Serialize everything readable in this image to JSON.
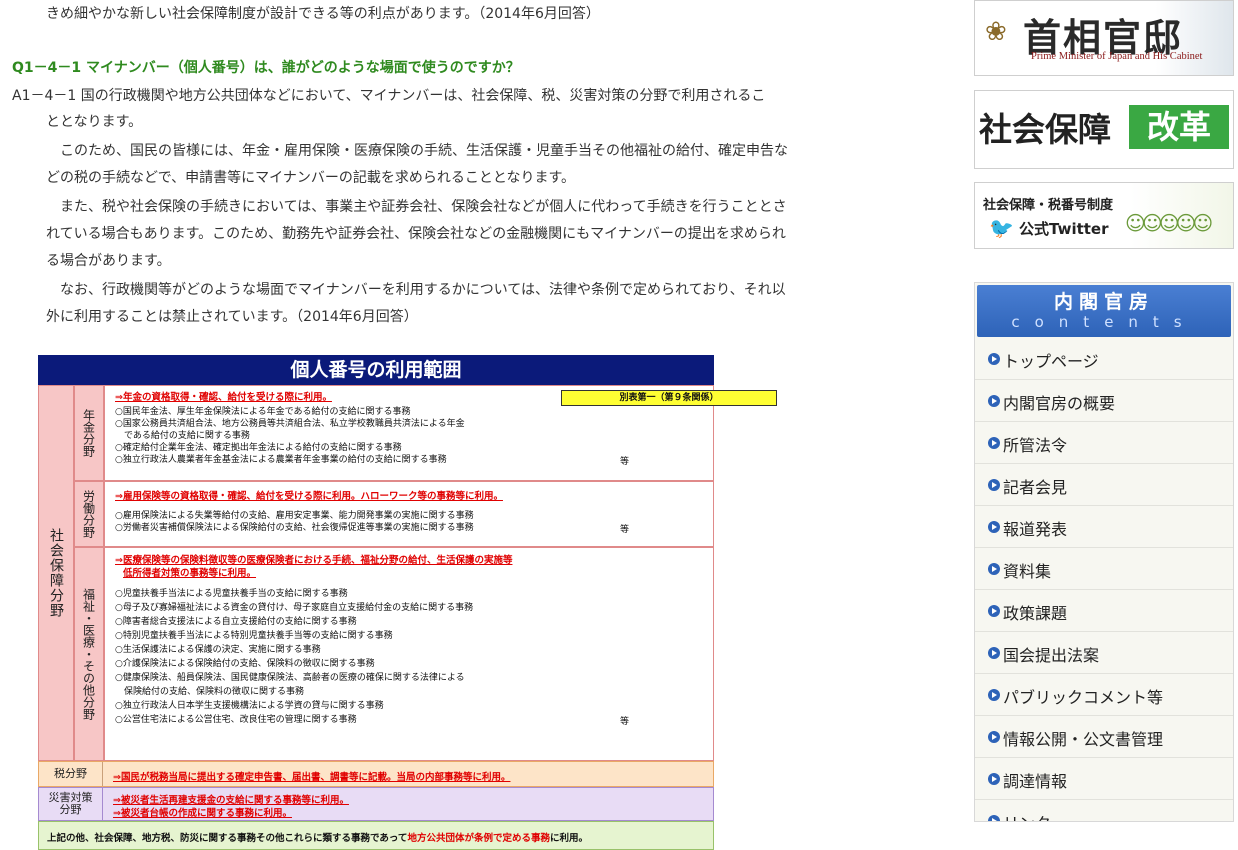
{
  "article": {
    "line0": "きめ細やかな新しい社会保障制度が設計できる等の利点があります。（2014年6月回答）",
    "question": "Q1－4－1 マイナンバー（個人番号）は、誰がどのような場面で使うのですか？",
    "answer_lines": [
      "A1－4－1 国の行政機関や地方公共団体などにおいて、マイナンバーは、社会保障、税、災害対策の分野で利用されるこ",
      "ととなります。",
      "このため、国民の皆様には、年金・雇用保険・医療保険の手続、生活保護・児童手当その他福祉の給付、確定申告な",
      "どの税の手続などで、申請書等にマイナンバーの記載を求められることとなります。",
      "また、税や社会保険の手続きにおいては、事業主や証券会社、保険会社などが個人に代わって手続きを行うこととさ",
      "れている場合もあります。このため、勤務先や証券会社、保険会社などの金融機関にもマイナンバーの提出を求められ",
      "る場合があります。",
      "なお、行政機関等がどのような場面でマイナンバーを利用するかについては、法律や条例で定められており、それ以",
      "外に利用することは禁止されています。（2014年6月回答）"
    ]
  },
  "figure": {
    "title": "個人番号の利用範囲",
    "badge": "別表第一（第９条関係）",
    "main_label": "社会保障分野",
    "pension": {
      "label": "年金分野",
      "headline": "⇒年金の資格取得・確認、給付を受ける際に利用。",
      "lines": [
        "○国民年金法、厚生年金保険法による年金である給付の支給に関する事務",
        "○国家公務員共済組合法、地方公務員等共済組合法、私立学校教職員共済法による年金",
        "　である給付の支給に関する事務",
        "○確定給付企業年金法、確定拠出年金法による給付の支給に関する事務",
        "○独立行政法人農業者年金基金法による農業者年金事業の給付の支給に関する事務"
      ],
      "etc": "等"
    },
    "labor": {
      "label": "労働分野",
      "headline": "⇒雇用保険等の資格取得・確認、給付を受ける際に利用。ハローワーク等の事務等に利用。",
      "lines": [
        "○雇用保険法による失業等給付の支給、雇用安定事業、能力開発事業の実施に関する事務",
        "○労働者災害補償保険法による保険給付の支給、社会復帰促進等事業の実施に関する事務"
      ],
      "etc": "等"
    },
    "welfare": {
      "label": "福祉・医療・その他分野",
      "headline1": "⇒医療保険等の保険料徴収等の医療保険者における手続、福祉分野の給付、生活保護の実施等",
      "headline2": "低所得者対策の事務等に利用。",
      "lines": [
        "○児童扶養手当法による児童扶養手当の支給に関する事務",
        "○母子及び寡婦福祉法による資金の貸付け、母子家庭自立支援給付金の支給に関する事務",
        "○障害者総合支援法による自立支援給付の支給に関する事務",
        "○特別児童扶養手当法による特別児童扶養手当等の支給に関する事務",
        "○生活保護法による保護の決定、実施に関する事務",
        "○介護保険法による保険給付の支給、保険料の徴収に関する事務",
        "○健康保険法、船員保険法、国民健康保険法、高齢者の医療の確保に関する法律による",
        "　保険給付の支給、保険料の徴収に関する事務",
        "○独立行政法人日本学生支援機構法による学資の貸与に関する事務",
        "○公営住宅法による公営住宅、改良住宅の管理に関する事務"
      ],
      "etc": "等"
    },
    "tax": {
      "label": "税分野",
      "text": "⇒国民が税務当局に提出する確定申告書、届出書、調書等に記載。当局の内部事務等に利用。"
    },
    "disaster": {
      "label": "災害対策分野",
      "line1": "⇒被災者生活再建支援金の支給に関する事務等に利用。",
      "line2": "⇒被災者台帳の作成に関する事務に利用。"
    },
    "other": {
      "text_a": "上記の他、社会保障、地方税、防災に関する事務その他これらに類する事務であって",
      "text_b": "地方公共団体が条例で定める事務",
      "text_c": "に利用。"
    }
  },
  "sidebar": {
    "kantei": {
      "name": "首相官邸",
      "english": "Prime Minister of Japan and His Cabinet"
    },
    "reform": {
      "part1": "社会保障",
      "part2": "改革"
    },
    "twitter": {
      "line1": "社会保障・税番号制度",
      "line2": "公式Twitter"
    },
    "menu_title": "内閣官房",
    "menu_subtitle": "contents",
    "menu_items": [
      "トップページ",
      "内閣官房の概要",
      "所管法令",
      "記者会見",
      "報道発表",
      "資料集",
      "政策課題",
      "国会提出法案",
      "パブリックコメント等",
      "情報公開・公文書管理",
      "調達情報",
      "リンク"
    ]
  }
}
